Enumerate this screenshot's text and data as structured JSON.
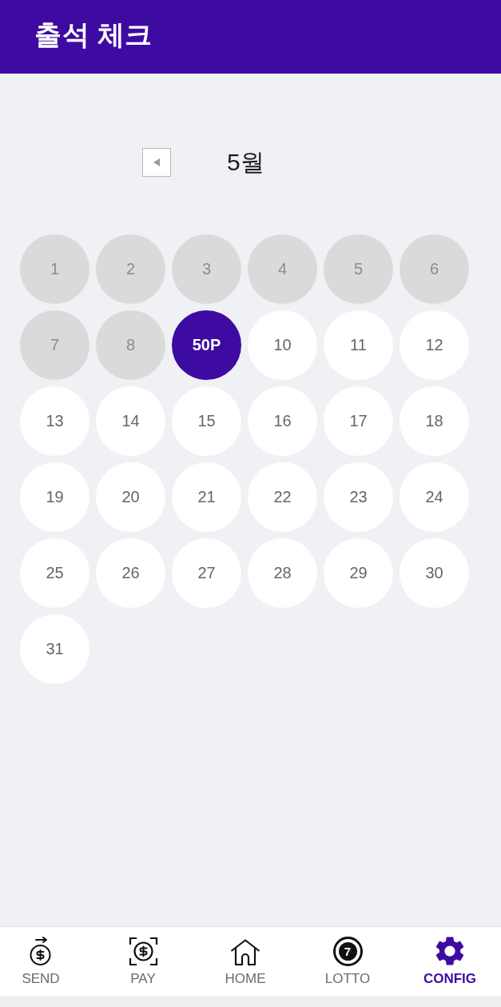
{
  "header": {
    "title": "출석 체크"
  },
  "calendar": {
    "month": "5월",
    "days": [
      {
        "label": "1",
        "kind": "past"
      },
      {
        "label": "2",
        "kind": "past"
      },
      {
        "label": "3",
        "kind": "past"
      },
      {
        "label": "4",
        "kind": "past"
      },
      {
        "label": "5",
        "kind": "past"
      },
      {
        "label": "6",
        "kind": "past"
      },
      {
        "label": "7",
        "kind": "past"
      },
      {
        "label": "8",
        "kind": "past"
      },
      {
        "label": "50P",
        "kind": "checked"
      },
      {
        "label": "10",
        "kind": "future"
      },
      {
        "label": "11",
        "kind": "future"
      },
      {
        "label": "12",
        "kind": "future"
      },
      {
        "label": "13",
        "kind": "future"
      },
      {
        "label": "14",
        "kind": "future"
      },
      {
        "label": "15",
        "kind": "future"
      },
      {
        "label": "16",
        "kind": "future"
      },
      {
        "label": "17",
        "kind": "future"
      },
      {
        "label": "18",
        "kind": "future"
      },
      {
        "label": "19",
        "kind": "future"
      },
      {
        "label": "20",
        "kind": "future"
      },
      {
        "label": "21",
        "kind": "future"
      },
      {
        "label": "22",
        "kind": "future"
      },
      {
        "label": "23",
        "kind": "future"
      },
      {
        "label": "24",
        "kind": "future"
      },
      {
        "label": "25",
        "kind": "future"
      },
      {
        "label": "26",
        "kind": "future"
      },
      {
        "label": "27",
        "kind": "future"
      },
      {
        "label": "28",
        "kind": "future"
      },
      {
        "label": "29",
        "kind": "future"
      },
      {
        "label": "30",
        "kind": "future"
      },
      {
        "label": "31",
        "kind": "future"
      }
    ]
  },
  "nav": [
    {
      "label": "SEND",
      "selected": false
    },
    {
      "label": "PAY",
      "selected": false
    },
    {
      "label": "HOME",
      "selected": false
    },
    {
      "label": "LOTTO",
      "icon_text": "7",
      "selected": false
    },
    {
      "label": "CONFIG",
      "selected": true
    }
  ]
}
